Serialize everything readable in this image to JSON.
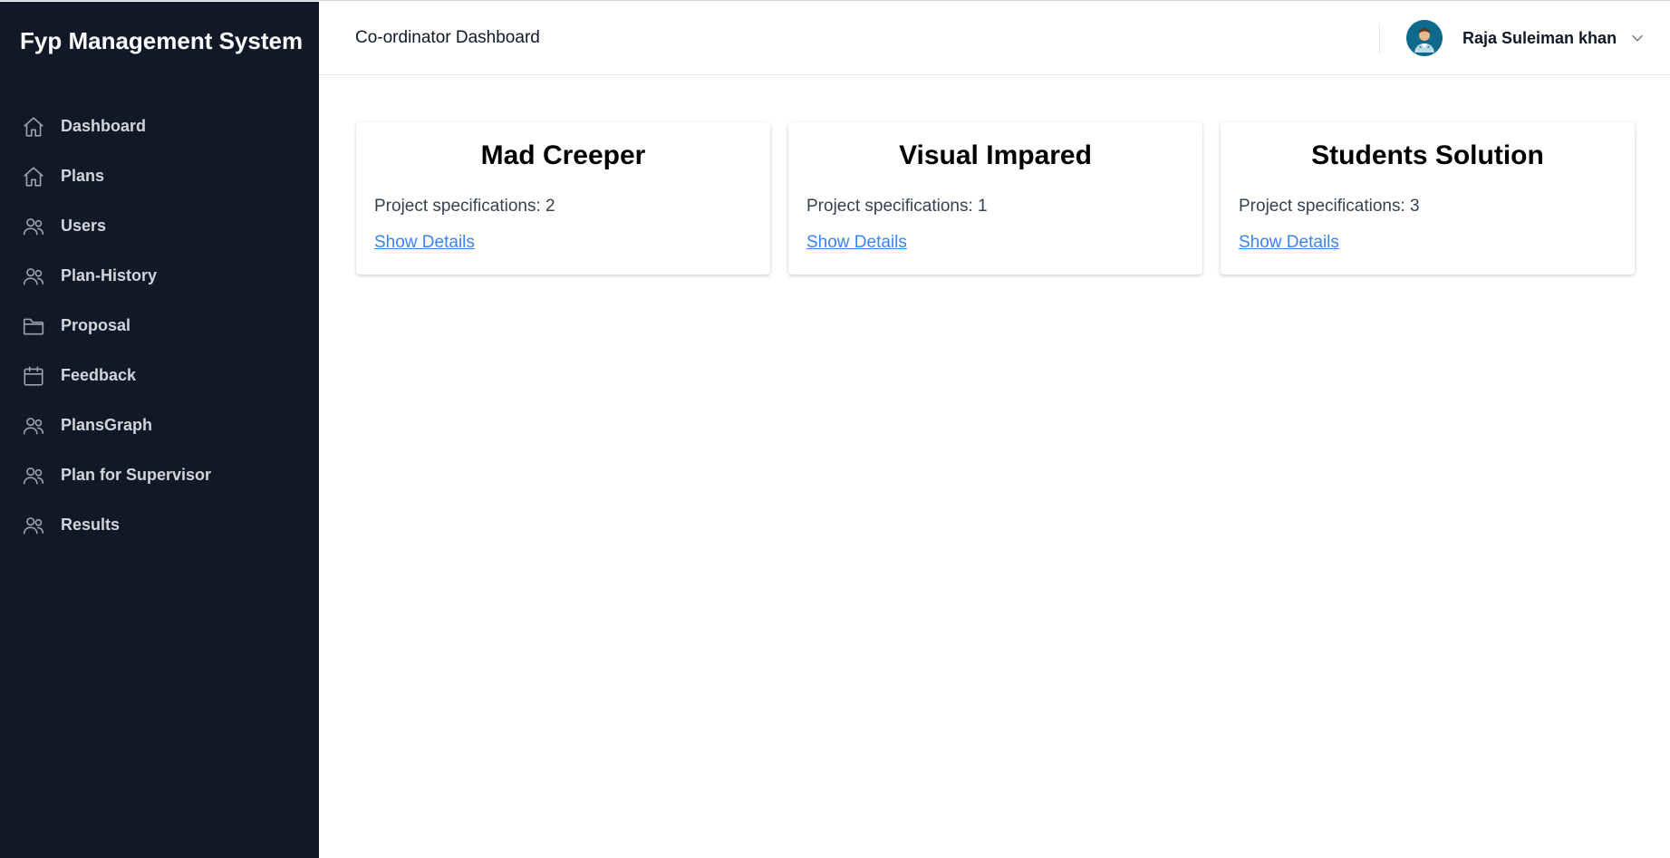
{
  "app": {
    "brand": "Fyp Management System"
  },
  "sidebar": {
    "items": [
      {
        "label": "Dashboard",
        "icon": "home-icon"
      },
      {
        "label": "Plans",
        "icon": "home-icon"
      },
      {
        "label": "Users",
        "icon": "users-icon"
      },
      {
        "label": "Plan-History",
        "icon": "users-icon"
      },
      {
        "label": "Proposal",
        "icon": "folder-icon"
      },
      {
        "label": "Feedback",
        "icon": "calendar-icon"
      },
      {
        "label": "PlansGraph",
        "icon": "users-icon"
      },
      {
        "label": "Plan for Supervisor",
        "icon": "users-icon"
      },
      {
        "label": "Results",
        "icon": "users-icon"
      }
    ]
  },
  "header": {
    "title": "Co-ordinator Dashboard",
    "user_name": "Raja Suleiman khan"
  },
  "cards": [
    {
      "title": "Mad Creeper",
      "spec": "Project specifications: 2",
      "link": "Show Details"
    },
    {
      "title": "Visual Impared",
      "spec": "Project specifications: 1",
      "link": "Show Details"
    },
    {
      "title": "Students Solution",
      "spec": "Project specifications: 3",
      "link": "Show Details"
    }
  ],
  "colors": {
    "sidebar_bg": "#111827",
    "link": "#3b82f6",
    "avatar_bg": "#0e6a8c"
  }
}
